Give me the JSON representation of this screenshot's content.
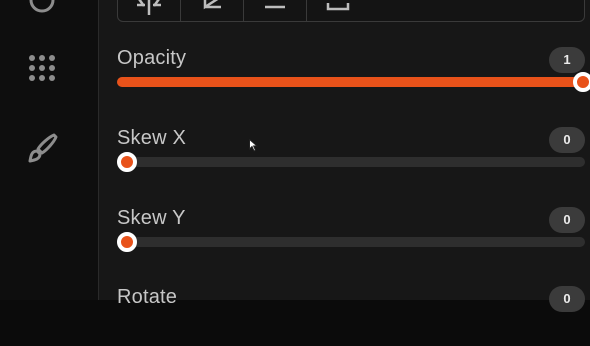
{
  "sidebar": {
    "items": [
      {
        "icon": "circle-icon"
      },
      {
        "icon": "grid-dots-icon"
      },
      {
        "icon": "paintbrush-icon"
      }
    ]
  },
  "toolbar": {
    "buttons": [
      {
        "icon": "align-center-icon"
      },
      {
        "icon": "triangle-flag-icon"
      },
      {
        "icon": "minus-icon"
      },
      {
        "icon": "bracket-icon"
      }
    ]
  },
  "controls": [
    {
      "id": "opacity",
      "label": "Opacity",
      "value": "1",
      "fraction": 1.0,
      "fill": true
    },
    {
      "id": "skew-x",
      "label": "Skew X",
      "value": "0",
      "fraction": 0.0,
      "fill": false
    },
    {
      "id": "skew-y",
      "label": "Skew Y",
      "value": "0",
      "fraction": 0.0,
      "fill": false
    },
    {
      "id": "rotate",
      "label": "Rotate",
      "value": "0",
      "fraction": 0.0,
      "fill": false
    }
  ],
  "colors": {
    "accent": "#e8521a",
    "track": "#2e2e2e",
    "badge": "#3b3b3b"
  }
}
